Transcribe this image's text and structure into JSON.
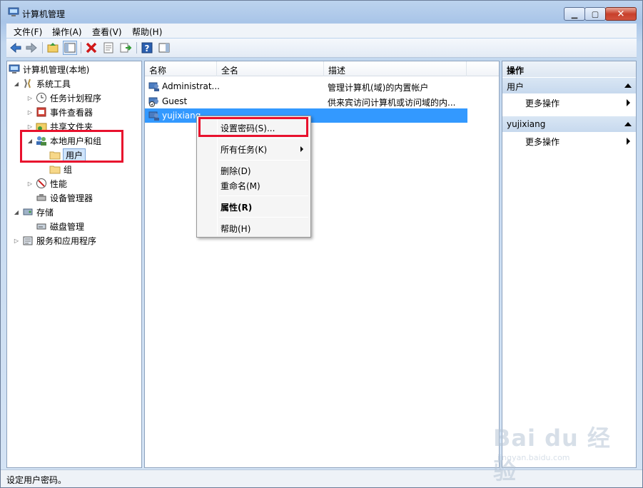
{
  "window": {
    "title": "计算机管理"
  },
  "menubar": {
    "items": [
      "文件(F)",
      "操作(A)",
      "查看(V)",
      "帮助(H)"
    ]
  },
  "tree": {
    "root": "计算机管理(本地)",
    "system_tools": "系统工具",
    "task_scheduler": "任务计划程序",
    "event_viewer": "事件查看器",
    "shared_folders": "共享文件夹",
    "local_users_groups": "本地用户和组",
    "users": "用户",
    "groups": "组",
    "performance": "性能",
    "device_manager": "设备管理器",
    "storage": "存储",
    "disk_management": "磁盘管理",
    "services_apps": "服务和应用程序"
  },
  "list": {
    "columns": [
      "名称",
      "全名",
      "描述"
    ],
    "rows": [
      {
        "name": "Administrat...",
        "fullname": "",
        "description": "管理计算机(域)的内置帐户"
      },
      {
        "name": "Guest",
        "fullname": "",
        "description": "供来宾访问计算机或访问域的内..."
      },
      {
        "name": "yujixiang",
        "fullname": "",
        "description": ""
      }
    ]
  },
  "actions": {
    "header": "操作",
    "section1": "用户",
    "more1": "更多操作",
    "section2": "yujixiang",
    "more2": "更多操作"
  },
  "context_menu": {
    "set_password": "设置密码(S)...",
    "all_tasks": "所有任务(K)",
    "delete": "删除(D)",
    "rename": "重命名(M)",
    "properties": "属性(R)",
    "help": "帮助(H)"
  },
  "status": {
    "text": "设定用户密码。"
  },
  "watermark": {
    "brand": "Bai du 经验",
    "url": "jingyan.baidu.com"
  },
  "colors": {
    "selection": "#3399ff",
    "highlight_box": "#e8112d"
  }
}
